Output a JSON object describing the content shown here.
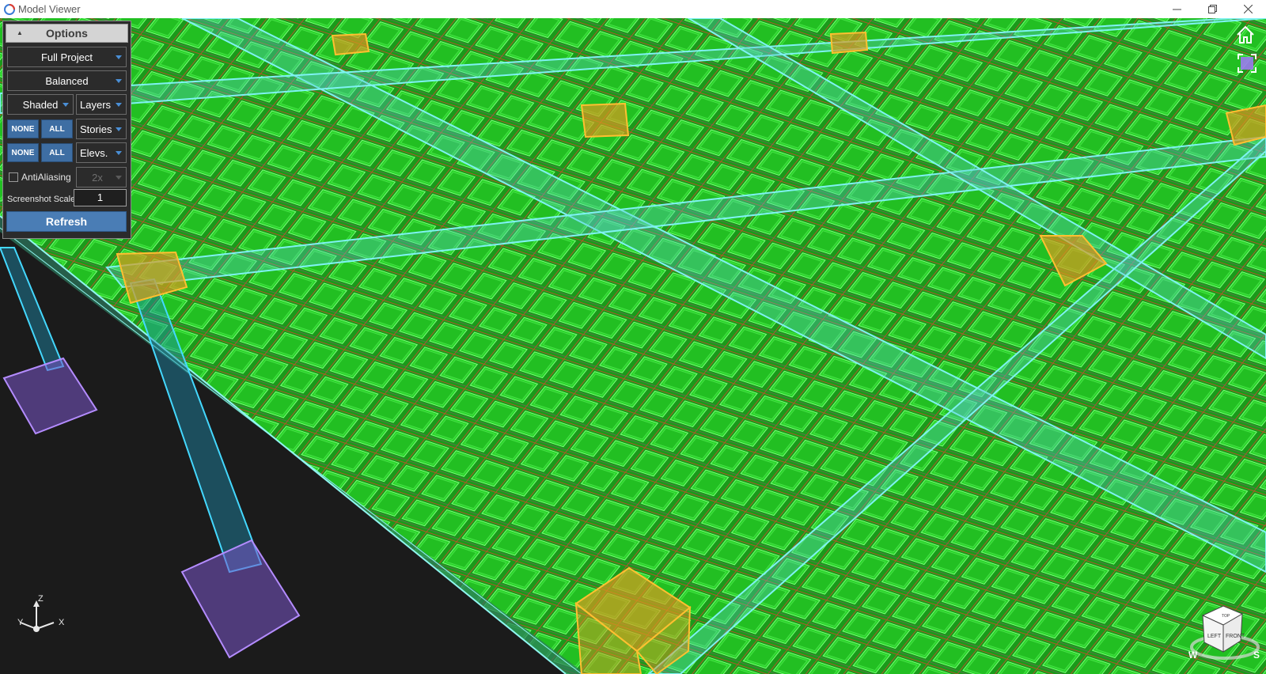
{
  "window": {
    "title": "Model Viewer"
  },
  "options_panel": {
    "header": "Options",
    "scope": "Full Project",
    "quality": "Balanced",
    "render_mode": "Shaded",
    "layers": "Layers",
    "stories_none": "NONE",
    "stories_all": "ALL",
    "stories": "Stories",
    "elevs_none": "NONE",
    "elevs_all": "ALL",
    "elevs": "Elevs.",
    "antialiasing_label": "AntiAliasing",
    "antialiasing_checked": false,
    "antialiasing_level": "2x",
    "screenshot_scale_label": "Screenshot Scale",
    "screenshot_scale_value": "1",
    "refresh": "Refresh"
  },
  "triad": {
    "x": "X",
    "y": "Y",
    "z": "Z"
  },
  "viewcube": {
    "top": "TOP",
    "left": "LEFT",
    "front": "FRONT",
    "compass_w": "W",
    "compass_s": "S"
  },
  "colors": {
    "slab_green": "#1fb81f",
    "beam_cyan": "#5de0e6",
    "column_cyan": "#2fb5e8",
    "footing_purple": "#9a6ee0",
    "node_orange": "#f0a820",
    "rebar_red": "#c0502a",
    "panel_button_blue": "#3e6ea3"
  }
}
